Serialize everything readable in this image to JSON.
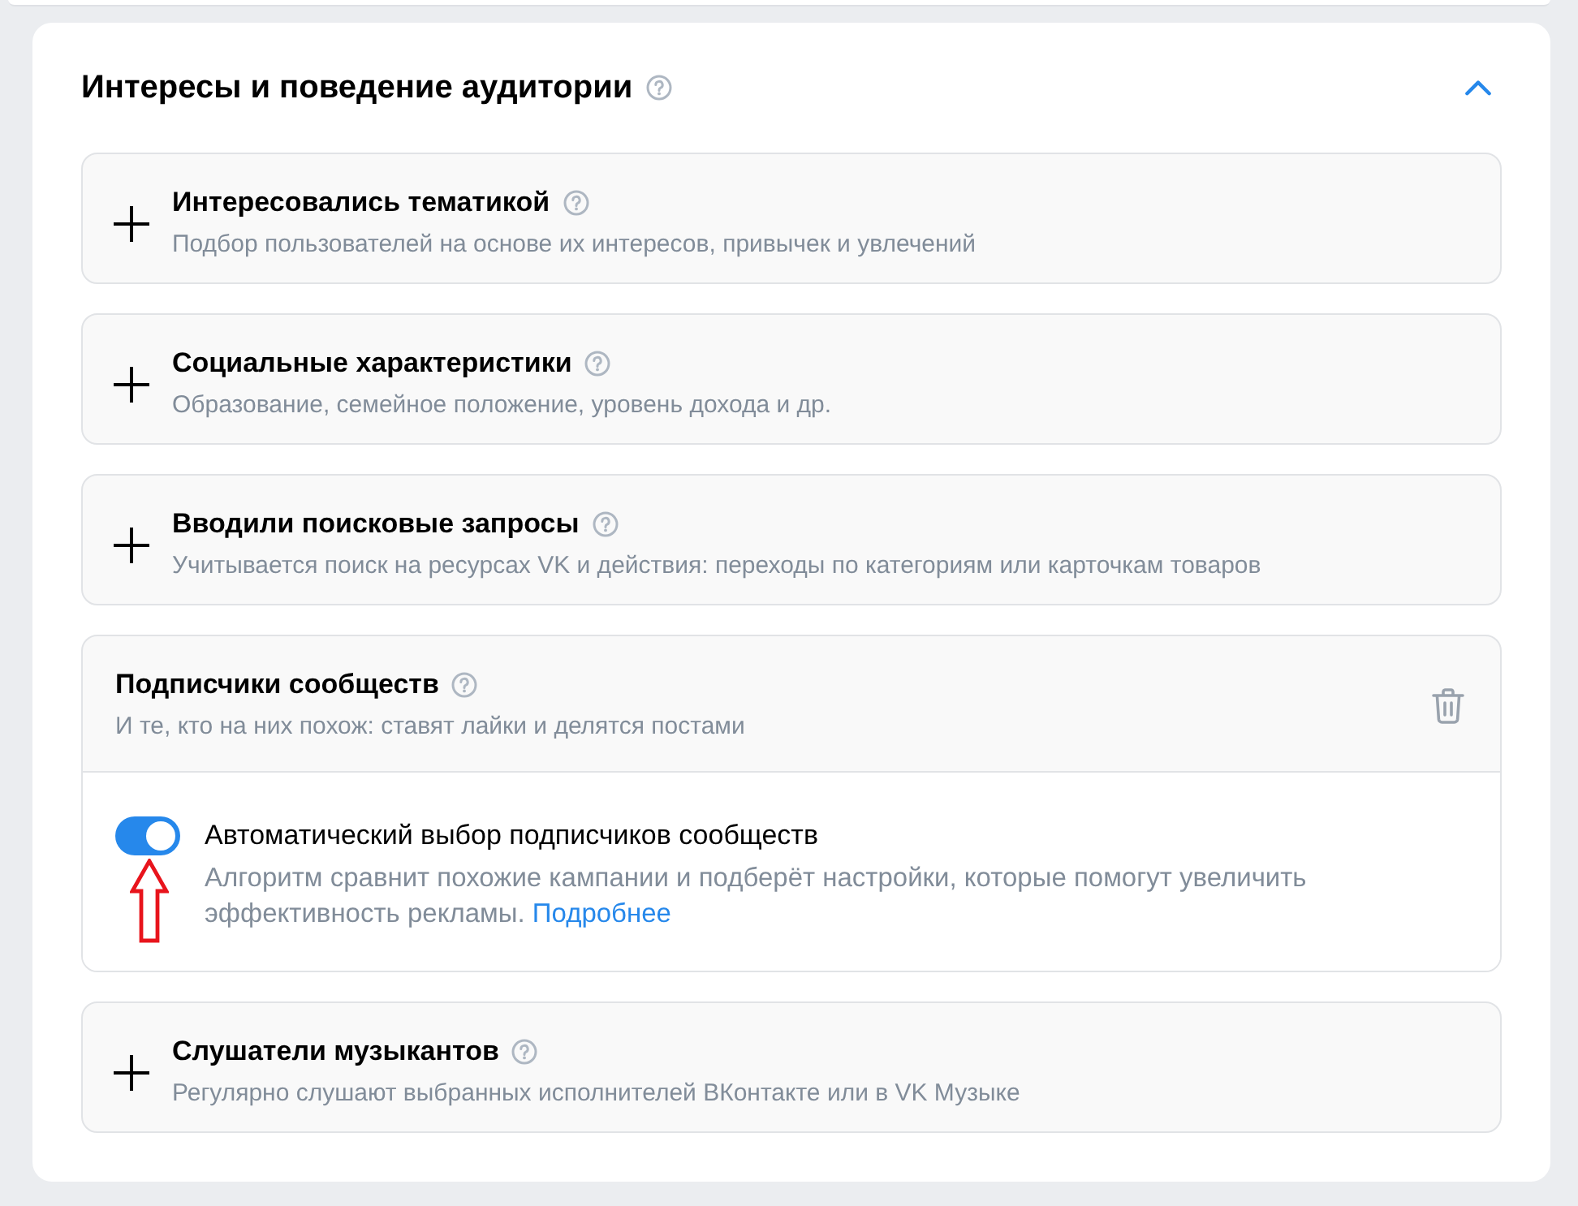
{
  "section": {
    "title": "Интересы и поведение аудитории",
    "expanded": true
  },
  "items": [
    {
      "title": "Интересовались тематикой",
      "description": "Подбор пользователей на основе их интересов, привычек и увлечений",
      "expanded": false
    },
    {
      "title": "Социальные характеристики",
      "description": "Образование, семейное положение, уровень дохода и др.",
      "expanded": false
    },
    {
      "title": "Вводили поисковые запросы",
      "description": "Учитывается поиск на ресурсах VK и действия: переходы по категориям или карточкам товаров",
      "expanded": false
    },
    {
      "title": "Подписчики сообществ",
      "description": "И те, кто на них похож: ставят лайки и делятся постами",
      "expanded": true,
      "option": {
        "label": "Автоматический выбор подписчиков сообществ",
        "on": true,
        "description": "Алгоритм сравнит похожие кампании и подберёт настройки, которые помогут увеличить эффективность рекламы.",
        "link": "Подробнее"
      }
    },
    {
      "title": "Слушатели музыкантов",
      "description": "Регулярно слушают выбранных исполнителей ВКонтакте или в VK Музыке",
      "expanded": false
    }
  ]
}
